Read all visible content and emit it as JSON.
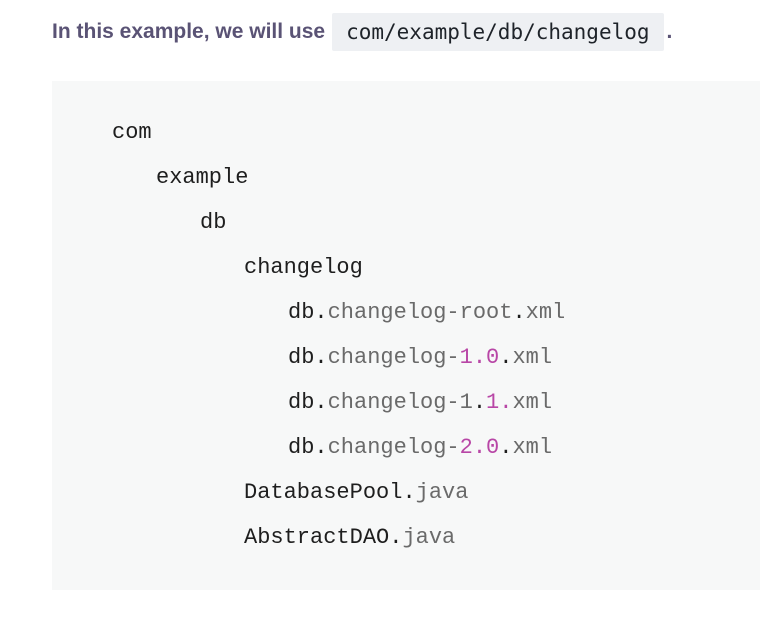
{
  "intro": {
    "text": "In this example, we will use",
    "path": "com/example/db/changelog",
    "period": "."
  },
  "colors": {
    "intro_text": "#5a5375",
    "code_background": "#f7f8f8",
    "inline_code_background": "#eef0f3",
    "identifier": "#1e1e1e",
    "property": "#6a6a6a",
    "number": "#b846a6"
  },
  "tree": [
    {
      "depth": 0,
      "tokens": [
        {
          "type": "ident",
          "text": "com"
        }
      ]
    },
    {
      "depth": 1,
      "tokens": [
        {
          "type": "ident",
          "text": "example"
        }
      ]
    },
    {
      "depth": 2,
      "tokens": [
        {
          "type": "ident",
          "text": "db"
        }
      ]
    },
    {
      "depth": 3,
      "tokens": [
        {
          "type": "ident",
          "text": "changelog"
        }
      ]
    },
    {
      "depth": 4,
      "tokens": [
        {
          "type": "ident",
          "text": "db"
        },
        {
          "type": "punct",
          "text": "."
        },
        {
          "type": "prop",
          "text": "changelog-root"
        },
        {
          "type": "punct",
          "text": "."
        },
        {
          "type": "prop",
          "text": "xml"
        }
      ]
    },
    {
      "depth": 4,
      "tokens": [
        {
          "type": "ident",
          "text": "db"
        },
        {
          "type": "punct",
          "text": "."
        },
        {
          "type": "prop",
          "text": "changelog-"
        },
        {
          "type": "num",
          "text": "1.0"
        },
        {
          "type": "punct",
          "text": "."
        },
        {
          "type": "prop",
          "text": "xml"
        }
      ]
    },
    {
      "depth": 4,
      "tokens": [
        {
          "type": "ident",
          "text": "db"
        },
        {
          "type": "punct",
          "text": "."
        },
        {
          "type": "prop",
          "text": "changelog-1"
        },
        {
          "type": "punct",
          "text": "."
        },
        {
          "type": "num",
          "text": "1."
        },
        {
          "type": "prop",
          "text": "xml"
        }
      ]
    },
    {
      "depth": 4,
      "tokens": [
        {
          "type": "ident",
          "text": "db"
        },
        {
          "type": "punct",
          "text": "."
        },
        {
          "type": "prop",
          "text": "changelog-"
        },
        {
          "type": "num",
          "text": "2.0"
        },
        {
          "type": "punct",
          "text": "."
        },
        {
          "type": "prop",
          "text": "xml"
        }
      ]
    },
    {
      "depth": 3,
      "tokens": [
        {
          "type": "ident",
          "text": "DatabasePool"
        },
        {
          "type": "punct",
          "text": "."
        },
        {
          "type": "prop",
          "text": "java"
        }
      ]
    },
    {
      "depth": 3,
      "tokens": [
        {
          "type": "ident",
          "text": "AbstractDAO"
        },
        {
          "type": "punct",
          "text": "."
        },
        {
          "type": "prop",
          "text": "java"
        }
      ]
    }
  ]
}
